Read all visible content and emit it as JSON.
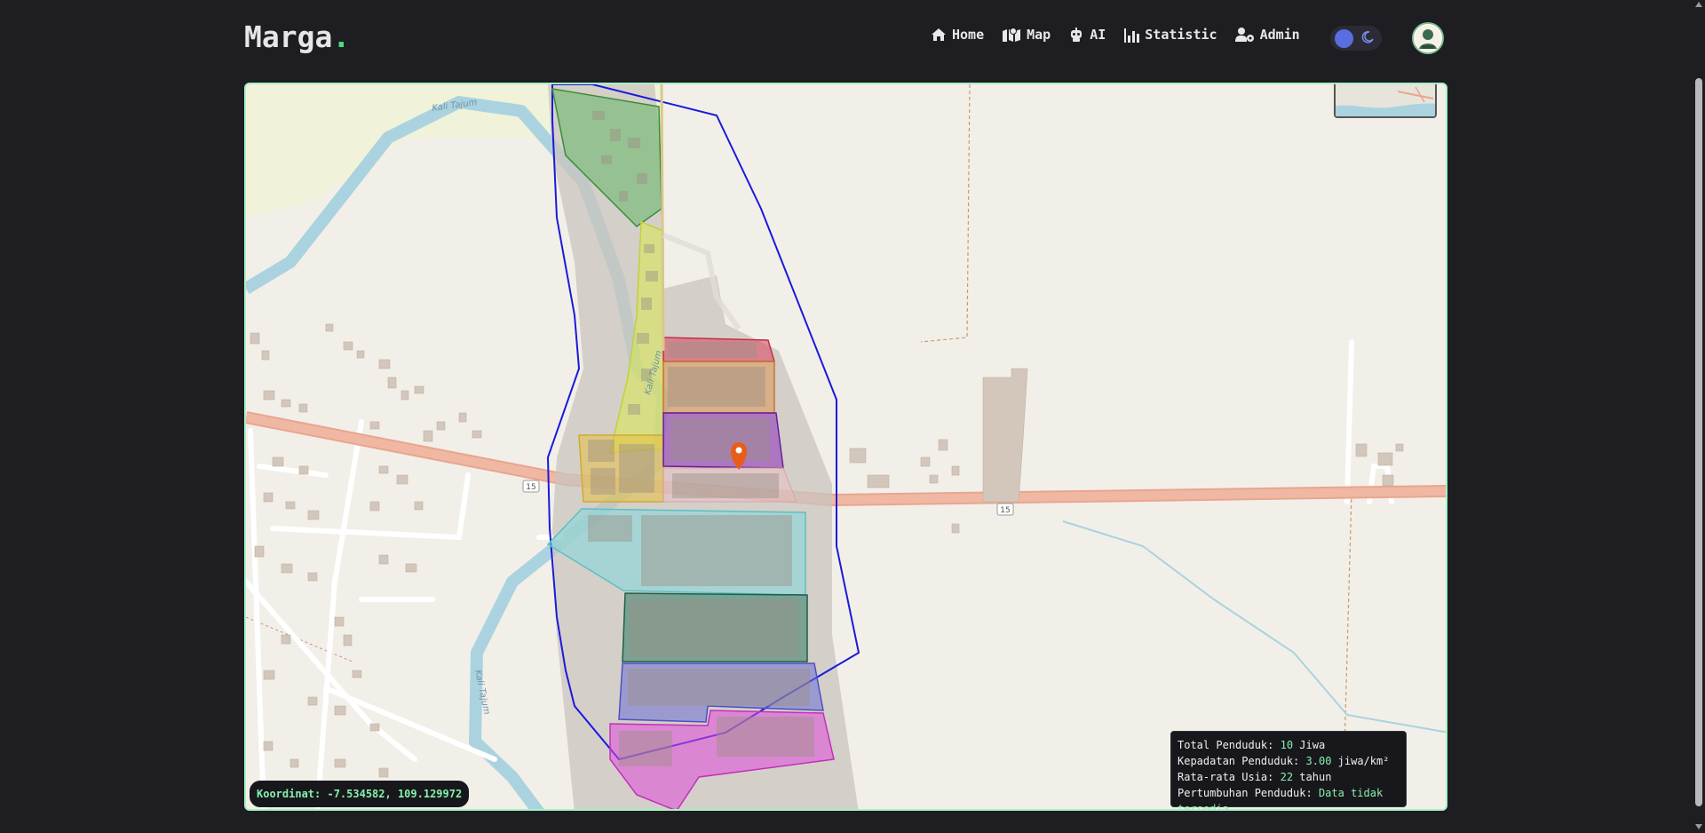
{
  "app": {
    "logo_text": "Marga",
    "logo_dot": ".",
    "accent_color": "#4ade80"
  },
  "nav": {
    "items": [
      {
        "label": "Home",
        "icon": "home-icon"
      },
      {
        "label": "Map",
        "icon": "map-icon"
      },
      {
        "label": "AI",
        "icon": "robot-icon"
      },
      {
        "label": "Statistic",
        "icon": "bar-chart-icon"
      },
      {
        "label": "Admin",
        "icon": "user-gear-icon"
      }
    ],
    "theme_toggle": {
      "state": "dark",
      "icon": "moon-icon"
    },
    "avatar_icon": "avatar-icon"
  },
  "map": {
    "labels": {
      "river_1": "Kali Tajum",
      "river_2": "Kali Tajum",
      "river_3": "Kali Tajum",
      "road_shield_1": "15",
      "road_shield_2": "15"
    },
    "marker_icon": "location-pin-icon",
    "colors": {
      "boundary": "#1a1adb",
      "zone_green": "#4caf50",
      "zone_yellow": "#d4e04a",
      "zone_red": "#d9415a",
      "zone_orange": "#e0883a",
      "zone_purple": "#8b2fb8",
      "zone_gold": "#e6c040",
      "zone_cyan": "#7fd8dc",
      "zone_teal": "#2e7d64",
      "zone_blue": "#6b6fd6",
      "zone_magenta": "#e04ad8"
    }
  },
  "coordinates": {
    "label": "Koordinat:",
    "value": "-7.534582, 109.129972"
  },
  "stats": {
    "population_label": "Total Penduduk:",
    "population_value": "10",
    "population_unit": "Jiwa",
    "density_label": "Kepadatan Penduduk:",
    "density_value": "3.00",
    "density_unit": "jiwa/km²",
    "age_label": "Rata-rata Usia:",
    "age_value": "22",
    "age_unit": "tahun",
    "growth_label": "Pertumbuhan Penduduk:",
    "growth_value": "Data tidak tersedia"
  }
}
